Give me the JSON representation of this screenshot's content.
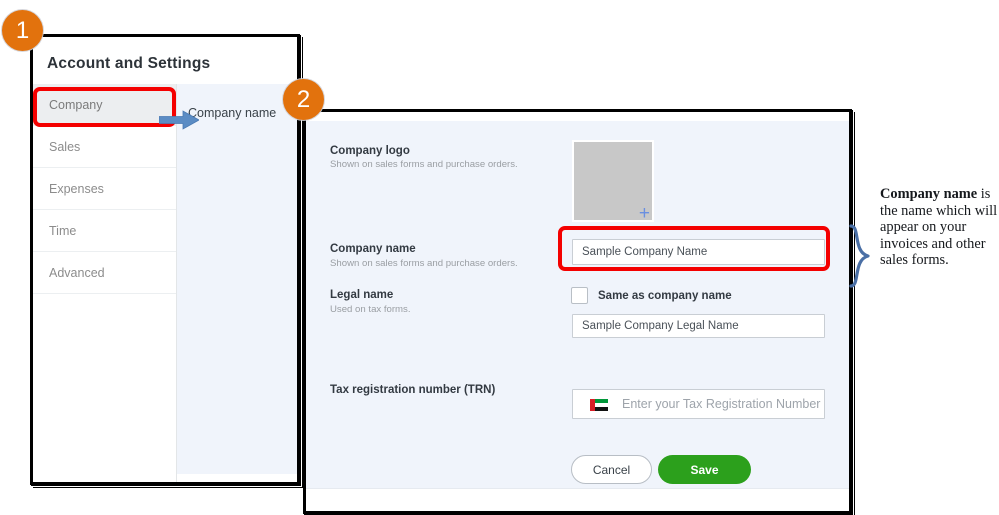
{
  "step_badges": [
    {
      "name": "step-1",
      "label": "1"
    },
    {
      "name": "step-2",
      "label": "2"
    }
  ],
  "window1": {
    "title": "Account and Settings",
    "sidebar": {
      "items": [
        {
          "label": "Company",
          "active": true
        },
        {
          "label": "Sales",
          "active": false
        },
        {
          "label": "Expenses",
          "active": false
        },
        {
          "label": "Time",
          "active": false
        },
        {
          "label": "Advanced",
          "active": false
        }
      ]
    },
    "content_title": "Company name"
  },
  "window2": {
    "company_logo": {
      "label": "Company logo",
      "sublabel": "Shown on sales forms and purchase orders.",
      "add_icon": "+"
    },
    "company_name": {
      "label": "Company name",
      "sublabel": "Shown on sales forms and purchase orders.",
      "value": "Sample Company Name"
    },
    "legal_name": {
      "label": "Legal name",
      "sublabel": "Used on tax forms.",
      "checkbox_label": "Same as company name",
      "checkbox_checked": false,
      "value": "Sample Company Legal Name"
    },
    "trn": {
      "label": "Tax registration number (TRN)",
      "placeholder": "Enter your Tax Registration Number",
      "flag_icon": "uae-flag-icon"
    },
    "buttons": {
      "cancel": "Cancel",
      "save": "Save"
    }
  },
  "annotation": {
    "bold_text": "Company name",
    "rest_text": " is the name which will appear on your invoices and other sales forms."
  },
  "colors": {
    "badge_orange": "#e2720d",
    "highlight_red": "#f40000",
    "save_green": "#2ca01c",
    "arrow_blue": "#5b8cc4",
    "panel_blue": "#f0f4fb"
  }
}
